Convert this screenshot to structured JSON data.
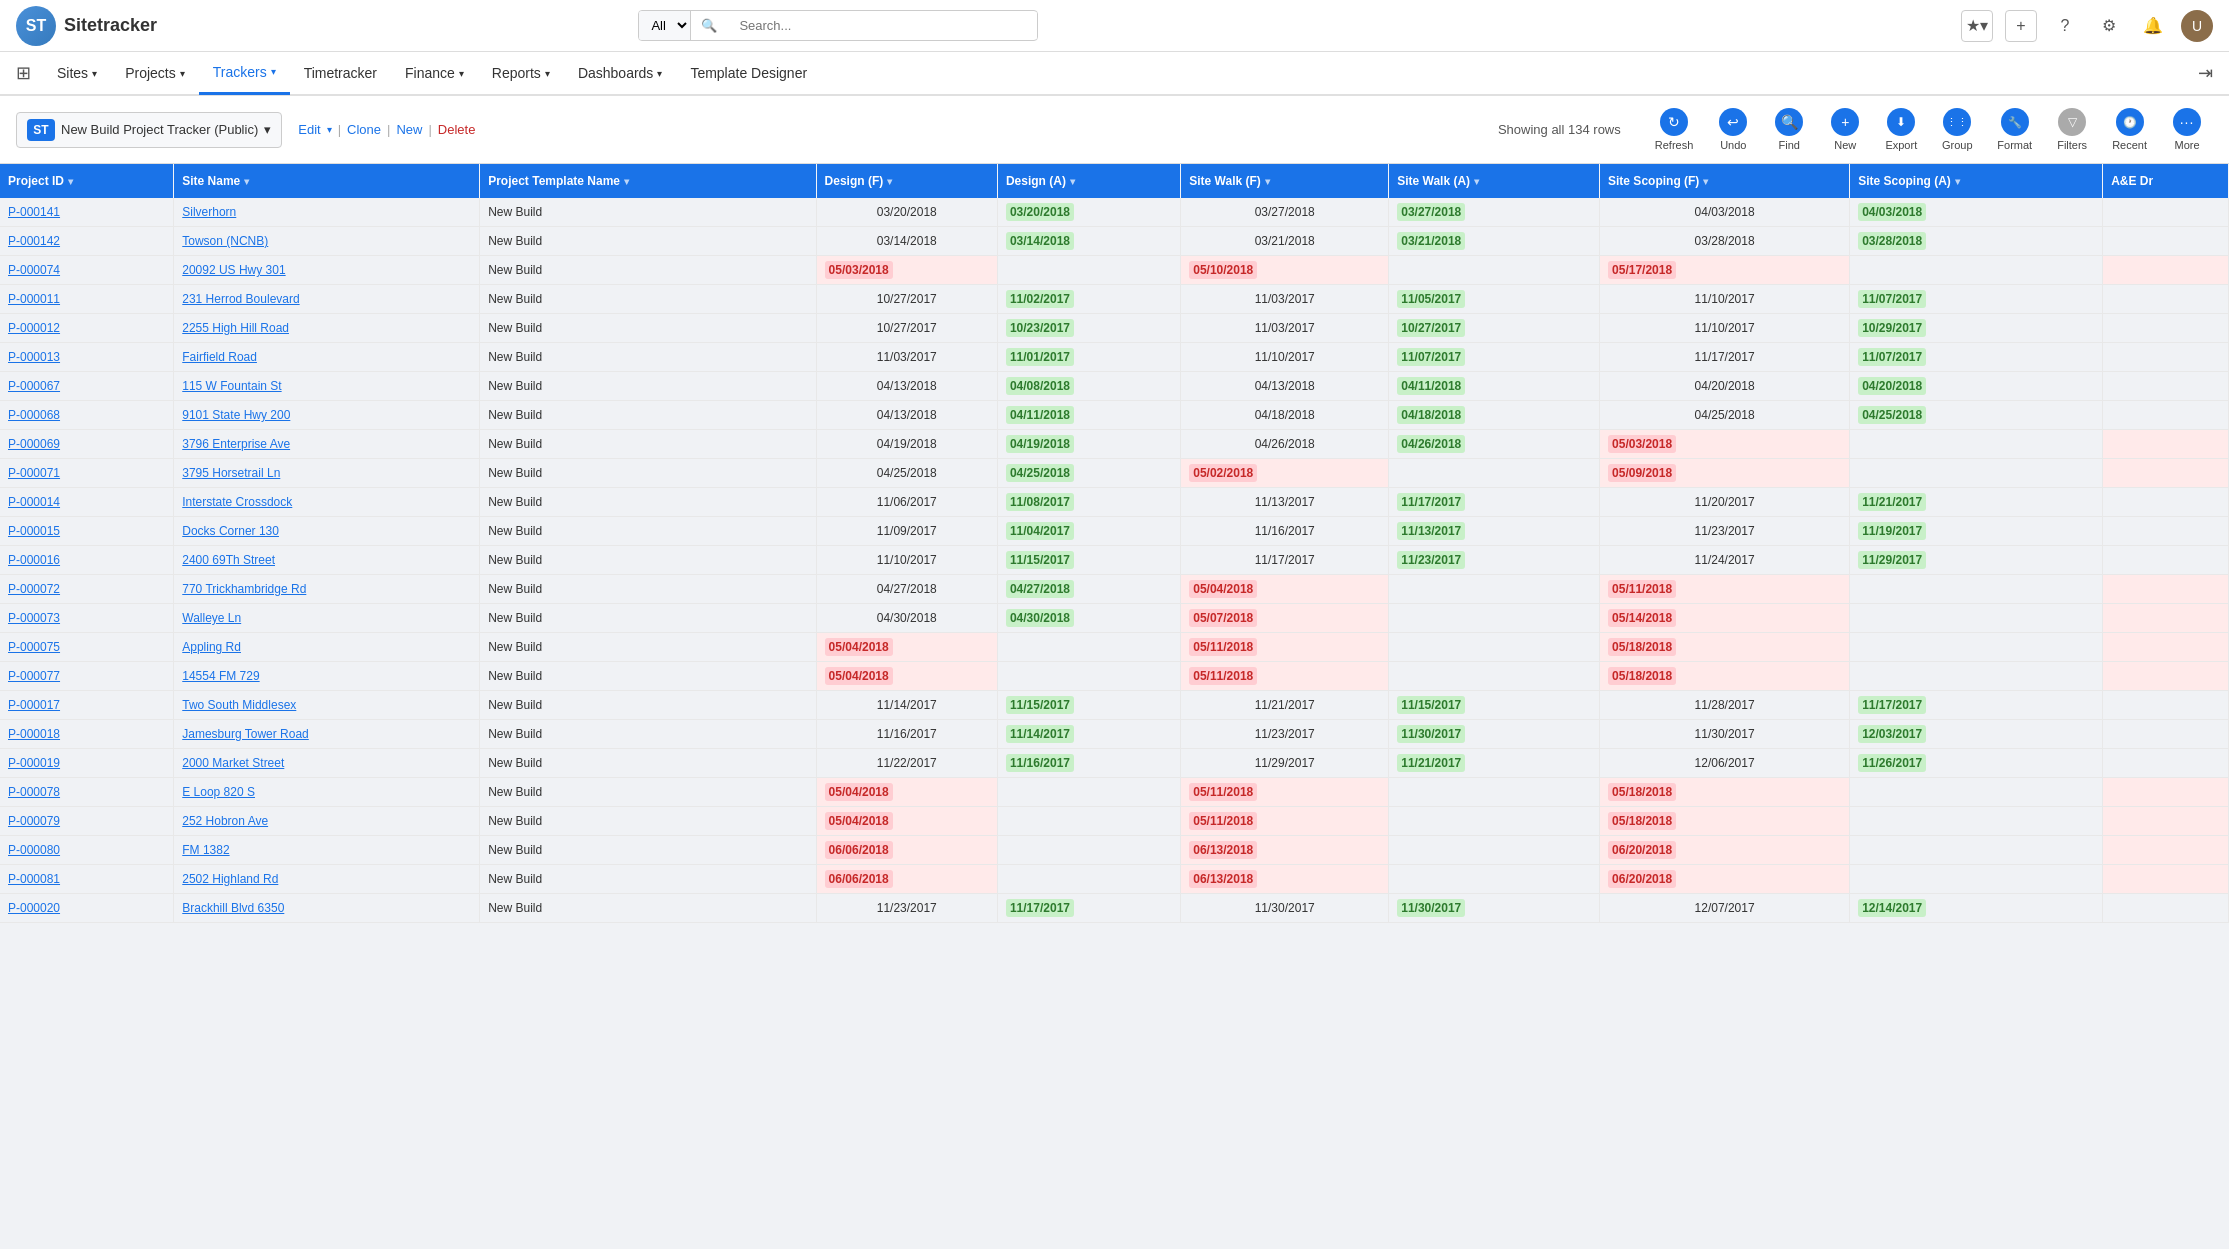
{
  "topNav": {
    "logo": "ST",
    "appName": "Sitetracker",
    "searchPlaceholder": "Search...",
    "searchAllOption": "All",
    "navIcons": [
      "★",
      "+",
      "?",
      "⚙",
      "🔔"
    ],
    "avatarInitial": "U"
  },
  "mainNav": {
    "items": [
      {
        "label": "Sites",
        "hasDropdown": true,
        "active": false
      },
      {
        "label": "Projects",
        "hasDropdown": true,
        "active": false
      },
      {
        "label": "Trackers",
        "hasDropdown": true,
        "active": true
      },
      {
        "label": "Timetracker",
        "hasDropdown": false,
        "active": false
      },
      {
        "label": "Finance",
        "hasDropdown": true,
        "active": false
      },
      {
        "label": "Reports",
        "hasDropdown": true,
        "active": false
      },
      {
        "label": "Dashboards",
        "hasDropdown": true,
        "active": false
      },
      {
        "label": "Template Designer",
        "hasDropdown": false,
        "active": false
      }
    ]
  },
  "toolbar": {
    "trackerName": "New Build Project Tracker (Public)",
    "stBadge": "ST",
    "editLabel": "Edit",
    "cloneLabel": "Clone",
    "newLabel": "New",
    "deleteLabel": "Delete",
    "rowCount": "Showing all 134 rows",
    "actions": [
      {
        "id": "refresh",
        "label": "Refresh",
        "icon": "↻",
        "iconStyle": "blue"
      },
      {
        "id": "undo",
        "label": "Undo",
        "icon": "↩",
        "iconStyle": "blue"
      },
      {
        "id": "find",
        "label": "Find",
        "icon": "🔍",
        "iconStyle": "blue"
      },
      {
        "id": "new",
        "label": "New",
        "icon": "+",
        "iconStyle": "blue"
      },
      {
        "id": "export",
        "label": "Export",
        "icon": "⬇",
        "iconStyle": "blue"
      },
      {
        "id": "group",
        "label": "Group",
        "icon": "⋮⋮",
        "iconStyle": "blue"
      },
      {
        "id": "format",
        "label": "Format",
        "icon": "🔧",
        "iconStyle": "blue"
      },
      {
        "id": "filters",
        "label": "Filters",
        "icon": "▽",
        "iconStyle": "gray"
      },
      {
        "id": "recent",
        "label": "Recent",
        "icon": "🕐",
        "iconStyle": "blue"
      },
      {
        "id": "more",
        "label": "More",
        "icon": "•••",
        "iconStyle": "blue"
      }
    ]
  },
  "table": {
    "columns": [
      "Project ID",
      "Site Name",
      "Project Template Name",
      "Design (F)",
      "Design (A)",
      "Site Walk (F)",
      "Site Walk (A)",
      "Site Scoping (F)",
      "Site Scoping (A)",
      "A&E Dr"
    ],
    "rows": [
      {
        "id": "P-000141",
        "site": "Silverhorn",
        "template": "New Build",
        "designF": "03/20/2018",
        "designA": "03/20/2018",
        "designAColor": "green",
        "siteWalkF": "03/27/2018",
        "siteWalkA": "03/27/2018",
        "siteWalkAColor": "green",
        "siteScopingF": "04/03/2018",
        "siteScopingA": "04/03/2018",
        "siteScopingAColor": "green"
      },
      {
        "id": "P-000142",
        "site": "Towson (NCNB)",
        "template": "New Build",
        "designF": "03/14/2018",
        "designA": "03/14/2018",
        "designAColor": "green",
        "siteWalkF": "03/21/2018",
        "siteWalkA": "03/21/2018",
        "siteWalkAColor": "green",
        "siteScopingF": "03/28/2018",
        "siteScopingA": "03/28/2018",
        "siteScopingAColor": "green"
      },
      {
        "id": "P-000074",
        "site": "20092 US Hwy 301",
        "template": "New Build",
        "designF": "05/03/2018",
        "designFColor": "pink",
        "designA": "",
        "siteWalkF": "05/10/2018",
        "siteWalkFColor": "pink",
        "siteWalkA": "",
        "siteScopingF": "05/17/2018",
        "siteScopingFColor": "pink",
        "siteScopingA": "",
        "rowPink": true
      },
      {
        "id": "P-000011",
        "site": "231 Herrod Boulevard",
        "template": "New Build",
        "designF": "10/27/2017",
        "designA": "11/02/2017",
        "designAColor": "green",
        "siteWalkF": "11/03/2017",
        "siteWalkA": "11/05/2017",
        "siteWalkAColor": "green",
        "siteScopingF": "11/10/2017",
        "siteScopingA": "11/07/2017",
        "siteScopingAColor": "green"
      },
      {
        "id": "P-000012",
        "site": "2255 High Hill Road",
        "template": "New Build",
        "designF": "10/27/2017",
        "designA": "10/23/2017",
        "designAColor": "green",
        "siteWalkF": "11/03/2017",
        "siteWalkA": "10/27/2017",
        "siteWalkAColor": "green",
        "siteScopingF": "11/10/2017",
        "siteScopingA": "10/29/2017",
        "siteScopingAColor": "green"
      },
      {
        "id": "P-000013",
        "site": "Fairfield Road",
        "template": "New Build",
        "designF": "11/03/2017",
        "designA": "11/01/2017",
        "designAColor": "green",
        "siteWalkF": "11/10/2017",
        "siteWalkA": "11/07/2017",
        "siteWalkAColor": "green",
        "siteScopingF": "11/17/2017",
        "siteScopingA": "11/07/2017",
        "siteScopingAColor": "green"
      },
      {
        "id": "P-000067",
        "site": "115 W Fountain St",
        "template": "New Build",
        "designF": "04/13/2018",
        "designA": "04/08/2018",
        "designAColor": "green",
        "siteWalkF": "04/13/2018",
        "siteWalkA": "04/11/2018",
        "siteWalkAColor": "green",
        "siteScopingF": "04/20/2018",
        "siteScopingA": "04/20/2018",
        "siteScopingAColor": "green"
      },
      {
        "id": "P-000068",
        "site": "9101 State Hwy 200",
        "template": "New Build",
        "designF": "04/13/2018",
        "designA": "04/11/2018",
        "designAColor": "green",
        "siteWalkF": "04/18/2018",
        "siteWalkA": "04/18/2018",
        "siteWalkAColor": "green",
        "siteScopingF": "04/25/2018",
        "siteScopingA": "04/25/2018",
        "siteScopingAColor": "green"
      },
      {
        "id": "P-000069",
        "site": "3796 Enterprise Ave",
        "template": "New Build",
        "designF": "04/19/2018",
        "designA": "04/19/2018",
        "designAColor": "green",
        "siteWalkF": "04/26/2018",
        "siteWalkA": "04/26/2018",
        "siteWalkAColor": "green",
        "siteScopingF": "05/03/2018",
        "siteScopingFColor": "pink",
        "siteScopingA": "",
        "rowPinkRight": true
      },
      {
        "id": "P-000071",
        "site": "3795 Horsetrail Ln",
        "template": "New Build",
        "designF": "04/25/2018",
        "designA": "04/25/2018",
        "designAColor": "green",
        "siteWalkF": "05/02/2018",
        "siteWalkFColor": "pink",
        "siteWalkA": "",
        "siteScopingF": "05/09/2018",
        "siteScopingFColor": "pink",
        "siteScopingA": "",
        "rowPinkRight": true
      },
      {
        "id": "P-000014",
        "site": "Interstate Crossdock",
        "template": "New Build",
        "designF": "11/06/2017",
        "designA": "11/08/2017",
        "designAColor": "green",
        "siteWalkF": "11/13/2017",
        "siteWalkA": "11/17/2017",
        "siteWalkAColor": "green",
        "siteScopingF": "11/20/2017",
        "siteScopingA": "11/21/2017",
        "siteScopingAColor": "green"
      },
      {
        "id": "P-000015",
        "site": "Docks Corner 130",
        "template": "New Build",
        "designF": "11/09/2017",
        "designA": "11/04/2017",
        "designAColor": "green",
        "siteWalkF": "11/16/2017",
        "siteWalkA": "11/13/2017",
        "siteWalkAColor": "green",
        "siteScopingF": "11/23/2017",
        "siteScopingA": "11/19/2017",
        "siteScopingAColor": "green"
      },
      {
        "id": "P-000016",
        "site": "2400 69Th Street",
        "template": "New Build",
        "designF": "11/10/2017",
        "designA": "11/15/2017",
        "designAColor": "green",
        "siteWalkF": "11/17/2017",
        "siteWalkA": "11/23/2017",
        "siteWalkAColor": "green",
        "siteScopingF": "11/24/2017",
        "siteScopingA": "11/29/2017",
        "siteScopingAColor": "green"
      },
      {
        "id": "P-000072",
        "site": "770 Trickhambridge Rd",
        "template": "New Build",
        "designF": "04/27/2018",
        "designA": "04/27/2018",
        "designAColor": "green",
        "siteWalkF": "05/04/2018",
        "siteWalkFColor": "pink",
        "siteWalkA": "",
        "siteScopingF": "05/11/2018",
        "siteScopingFColor": "pink",
        "siteScopingA": "",
        "rowPinkRight": true
      },
      {
        "id": "P-000073",
        "site": "Walleye Ln",
        "template": "New Build",
        "designF": "04/30/2018",
        "designA": "04/30/2018",
        "designAColor": "green",
        "siteWalkF": "05/07/2018",
        "siteWalkFColor": "pink",
        "siteWalkA": "",
        "siteScopingF": "05/14/2018",
        "siteScopingFColor": "pink",
        "siteScopingA": "",
        "rowPinkRight": true
      },
      {
        "id": "P-000075",
        "site": "Appling Rd",
        "template": "New Build",
        "designF": "05/04/2018",
        "designFColor": "pink",
        "designA": "",
        "siteWalkF": "05/11/2018",
        "siteWalkFColor": "pink",
        "siteWalkA": "",
        "siteScopingF": "05/18/2018",
        "siteScopingFColor": "pink",
        "siteScopingA": "",
        "rowPink": true
      },
      {
        "id": "P-000077",
        "site": "14554 FM 729",
        "template": "New Build",
        "designF": "05/04/2018",
        "designFColor": "pink",
        "designA": "",
        "siteWalkF": "05/11/2018",
        "siteWalkFColor": "pink",
        "siteWalkA": "",
        "siteScopingF": "05/18/2018",
        "siteScopingFColor": "pink",
        "siteScopingA": "",
        "rowPink": true
      },
      {
        "id": "P-000017",
        "site": "Two South Middlesex",
        "template": "New Build",
        "designF": "11/14/2017",
        "designA": "11/15/2017",
        "designAColor": "green",
        "siteWalkF": "11/21/2017",
        "siteWalkA": "11/15/2017",
        "siteWalkAColor": "green",
        "siteScopingF": "11/28/2017",
        "siteScopingA": "11/17/2017",
        "siteScopingAColor": "green"
      },
      {
        "id": "P-000018",
        "site": "Jamesburg Tower Road",
        "template": "New Build",
        "designF": "11/16/2017",
        "designA": "11/14/2017",
        "designAColor": "green",
        "siteWalkF": "11/23/2017",
        "siteWalkA": "11/30/2017",
        "siteWalkAColor": "green",
        "siteScopingF": "11/30/2017",
        "siteScopingA": "12/03/2017",
        "siteScopingAColor": "green"
      },
      {
        "id": "P-000019",
        "site": "2000 Market Street",
        "template": "New Build",
        "designF": "11/22/2017",
        "designA": "11/16/2017",
        "designAColor": "green",
        "siteWalkF": "11/29/2017",
        "siteWalkA": "11/21/2017",
        "siteWalkAColor": "green",
        "siteScopingF": "12/06/2017",
        "siteScopingA": "11/26/2017",
        "siteScopingAColor": "green"
      },
      {
        "id": "P-000078",
        "site": "E Loop 820 S",
        "template": "New Build",
        "designF": "05/04/2018",
        "designFColor": "pink",
        "designA": "",
        "siteWalkF": "05/11/2018",
        "siteWalkFColor": "pink",
        "siteWalkA": "",
        "siteScopingF": "05/18/2018",
        "siteScopingFColor": "pink",
        "siteScopingA": "",
        "rowPink": true
      },
      {
        "id": "P-000079",
        "site": "252 Hobron Ave",
        "template": "New Build",
        "designF": "05/04/2018",
        "designFColor": "pink",
        "designA": "",
        "siteWalkF": "05/11/2018",
        "siteWalkFColor": "pink",
        "siteWalkA": "",
        "siteScopingF": "05/18/2018",
        "siteScopingFColor": "pink",
        "siteScopingA": "",
        "rowPink": true
      },
      {
        "id": "P-000080",
        "site": "FM 1382",
        "template": "New Build",
        "designF": "06/06/2018",
        "designFColor": "pink",
        "designA": "",
        "siteWalkF": "06/13/2018",
        "siteWalkFColor": "pink",
        "siteWalkA": "",
        "siteScopingF": "06/20/2018",
        "siteScopingFColor": "pink",
        "siteScopingA": "",
        "rowPink": true
      },
      {
        "id": "P-000081",
        "site": "2502 Highland Rd",
        "template": "New Build",
        "designF": "06/06/2018",
        "designFColor": "pink",
        "designA": "",
        "siteWalkF": "06/13/2018",
        "siteWalkFColor": "pink",
        "siteWalkA": "",
        "siteScopingF": "06/20/2018",
        "siteScopingFColor": "pink",
        "siteScopingA": "",
        "rowPink": true
      },
      {
        "id": "P-000020",
        "site": "Brackhill Blvd 6350",
        "template": "New Build",
        "designF": "11/23/2017",
        "designA": "11/17/2017",
        "designAColor": "green",
        "siteWalkF": "11/30/2017",
        "siteWalkA": "11/30/2017",
        "siteWalkAColor": "green",
        "siteScopingF": "12/07/2017",
        "siteScopingA": "12/14/2017",
        "siteScopingAColor": "green"
      }
    ]
  }
}
